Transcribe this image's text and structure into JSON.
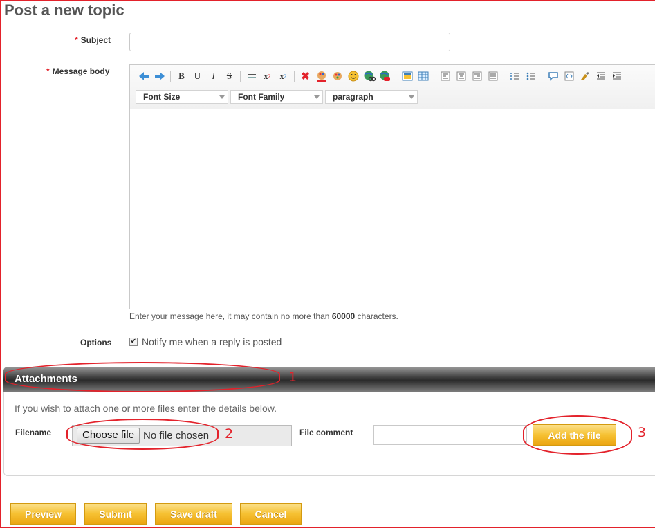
{
  "page": {
    "title": "Post a new topic"
  },
  "form": {
    "required_marker": "*",
    "subject_label": "Subject",
    "message_label": "Message body",
    "hint_prefix": "Enter your message here, it may contain no more than ",
    "hint_limit": "60000",
    "hint_suffix": " characters.",
    "options_label": "Options",
    "notify_label": "Notify me when a reply is posted",
    "notify_checked": true
  },
  "editor": {
    "selects": [
      "Font Size",
      "Font Family",
      "paragraph"
    ],
    "toolbar_icons": [
      "undo-icon",
      "redo-icon",
      "bold-icon",
      "underline-icon",
      "italic-icon",
      "strikethrough-icon",
      "horizontal-rule-icon",
      "superscript-icon",
      "subscript-icon",
      "remove-format-icon",
      "text-color-icon",
      "background-color-icon",
      "emoticon-icon",
      "link-icon",
      "unlink-icon",
      "image-icon",
      "table-icon",
      "align-left-icon",
      "align-center-icon",
      "align-right-icon",
      "align-justify-icon",
      "ordered-list-icon",
      "unordered-list-icon",
      "quote-icon",
      "code-icon",
      "cleanup-icon",
      "outdent-icon",
      "indent-icon"
    ]
  },
  "attachments": {
    "title": "Attachments",
    "instructions": "If you wish to attach one or more files enter the details below.",
    "filename_label": "Filename",
    "choose_file_label": "Choose file",
    "no_file_text": "No file chosen",
    "comment_label": "File comment",
    "add_file_label": "Add the file"
  },
  "actions": {
    "preview": "Preview",
    "submit": "Submit",
    "save_draft": "Save draft",
    "cancel": "Cancel"
  },
  "annotations": {
    "one": "1",
    "two": "2",
    "three": "3"
  },
  "colors": {
    "annotation_red": "#e3222b",
    "button_gold": "#f6c132",
    "header_dark": "#2b2b2b"
  }
}
